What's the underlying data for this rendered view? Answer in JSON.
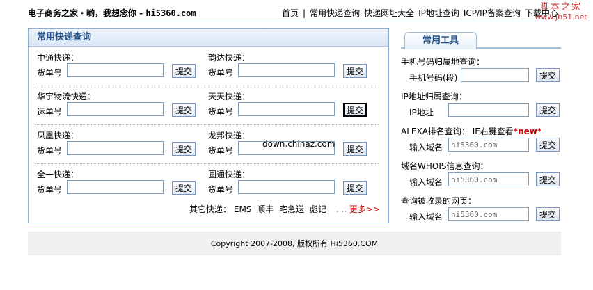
{
  "header": {
    "site_title_prefix": "电子商务之家・哟，我想念你 - ",
    "site_title_domain": "hi5360.com"
  },
  "nav": {
    "items": [
      "首页",
      "常用快递查询",
      "快递网址大全",
      "IP地址查询",
      "ICP/IP备案查询",
      "下载中心"
    ]
  },
  "watermark": {
    "line1": "脚本之家",
    "line2": "www.Jb51.net"
  },
  "main": {
    "title": "常用快递查询",
    "rows": [
      [
        {
          "title": "中通快递：",
          "label": "货单号",
          "value": "",
          "button": "提交"
        },
        {
          "title": "韵达快递：",
          "label": "货单号",
          "value": "",
          "button": "提交"
        }
      ],
      [
        {
          "title": "华宇物流快递：",
          "label": "运单号",
          "value": "",
          "button": "提交"
        },
        {
          "title": "天天快递：",
          "label": "货单号",
          "value": "",
          "button": "提交"
        }
      ],
      [
        {
          "title": "凤凰快递：",
          "label": "货单号",
          "value": "",
          "button": "提交"
        },
        {
          "title": "龙邦快递：",
          "label": "货单号",
          "value": "",
          "button": "提交"
        }
      ],
      [
        {
          "title": "全一快递：",
          "label": "货单号",
          "value": "",
          "button": "提交"
        },
        {
          "title": "圆通快递：",
          "label": "货单号",
          "value": "",
          "button": "提交"
        }
      ]
    ],
    "other_label": "其它快递：",
    "other_items": [
      "EMS",
      "顺丰",
      "宅急送",
      "彪记"
    ],
    "dots": "....",
    "more": "更多>>"
  },
  "overlay_text": "down.chinaz.com",
  "side": {
    "tab": "常用工具",
    "tools": [
      {
        "title": "手机号码归属地查询：",
        "title_new": "",
        "label": "手机号码(段)",
        "value": "",
        "button": "提交"
      },
      {
        "title": "IP地址归属查询：",
        "title_new": "",
        "label": "IP地址",
        "value": "",
        "button": "提交"
      },
      {
        "title": "ALEXA排名查询： IE右键查看",
        "title_new": "*new*",
        "label": "输入域名",
        "value": "hi5360.com",
        "button": "提交"
      },
      {
        "title": "域名WHOIS信息查询：",
        "title_new": "",
        "label": "输入域名",
        "value": "hi5360.com",
        "button": "提交"
      },
      {
        "title": "查询被收录的网页：",
        "title_new": "",
        "label": "输入域名",
        "value": "hi5360.com",
        "button": "提交"
      }
    ]
  },
  "footer": {
    "text": "Copyright 2007-2008, 版权所有 Hi5360.COM"
  }
}
